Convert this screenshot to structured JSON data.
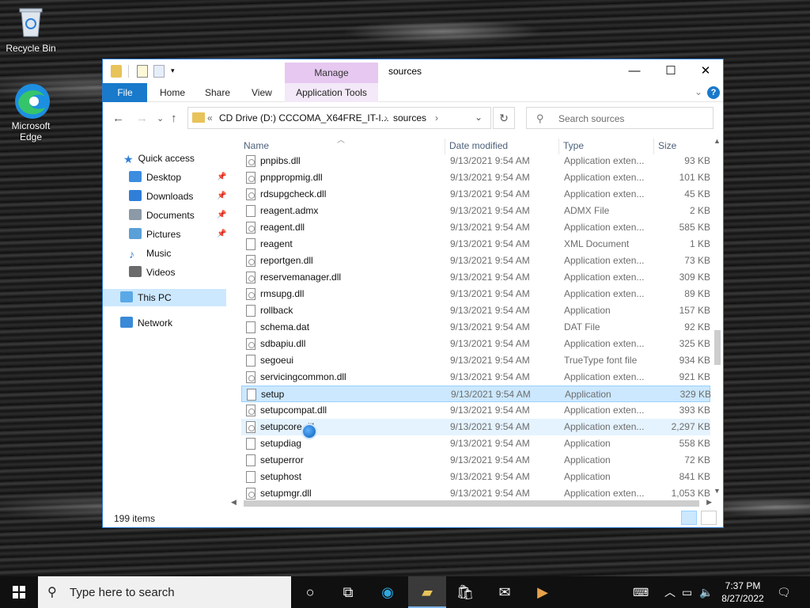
{
  "desktop": {
    "icons": [
      {
        "label": "Recycle Bin",
        "icon": "recycle-bin-icon"
      },
      {
        "label": "Microsoft Edge",
        "icon": "edge-icon"
      }
    ]
  },
  "window": {
    "title": "sources",
    "manage_tab": "Manage",
    "controls": {
      "minimize": "—",
      "maximize": "☐",
      "close": "✕"
    }
  },
  "ribbon": {
    "tabs": [
      "File",
      "Home",
      "Share",
      "View",
      "Application Tools"
    ],
    "help": "?"
  },
  "address": {
    "prefix": "«",
    "segments": [
      "CD Drive (D:) CCCOMA_X64FRE_IT-I...",
      "sources"
    ],
    "separator": "›"
  },
  "search": {
    "placeholder": "Search sources"
  },
  "nav": {
    "quick_access": "Quick access",
    "items": [
      {
        "label": "Desktop",
        "pinned": true,
        "color": "#3c8de0"
      },
      {
        "label": "Downloads",
        "pinned": true,
        "color": "#2f7fd8"
      },
      {
        "label": "Documents",
        "pinned": true,
        "color": "#8c9aa8"
      },
      {
        "label": "Pictures",
        "pinned": true,
        "color": "#5aa0d8"
      },
      {
        "label": "Music",
        "pinned": false,
        "color": "#2f7fd8"
      },
      {
        "label": "Videos",
        "pinned": false,
        "color": "#6b6b6b"
      }
    ],
    "this_pc": "This PC",
    "network": "Network",
    "pin_glyph": "📌"
  },
  "list": {
    "columns": {
      "name": "Name",
      "date": "Date modified",
      "type": "Type",
      "size": "Size"
    },
    "rows": [
      {
        "name": "pnpibs.dll",
        "date": "9/13/2021 9:54 AM",
        "type": "Application exten...",
        "size": "93 KB",
        "icon": "dll"
      },
      {
        "name": "pnppropmig.dll",
        "date": "9/13/2021 9:54 AM",
        "type": "Application exten...",
        "size": "101 KB",
        "icon": "dll"
      },
      {
        "name": "rdsupgcheck.dll",
        "date": "9/13/2021 9:54 AM",
        "type": "Application exten...",
        "size": "45 KB",
        "icon": "dll"
      },
      {
        "name": "reagent.admx",
        "date": "9/13/2021 9:54 AM",
        "type": "ADMX File",
        "size": "2 KB",
        "icon": "file"
      },
      {
        "name": "reagent.dll",
        "date": "9/13/2021 9:54 AM",
        "type": "Application exten...",
        "size": "585 KB",
        "icon": "dll"
      },
      {
        "name": "reagent",
        "date": "9/13/2021 9:54 AM",
        "type": "XML Document",
        "size": "1 KB",
        "icon": "file"
      },
      {
        "name": "reportgen.dll",
        "date": "9/13/2021 9:54 AM",
        "type": "Application exten...",
        "size": "73 KB",
        "icon": "dll"
      },
      {
        "name": "reservemanager.dll",
        "date": "9/13/2021 9:54 AM",
        "type": "Application exten...",
        "size": "309 KB",
        "icon": "dll"
      },
      {
        "name": "rmsupg.dll",
        "date": "9/13/2021 9:54 AM",
        "type": "Application exten...",
        "size": "89 KB",
        "icon": "dll"
      },
      {
        "name": "rollback",
        "date": "9/13/2021 9:54 AM",
        "type": "Application",
        "size": "157 KB",
        "icon": "file"
      },
      {
        "name": "schema.dat",
        "date": "9/13/2021 9:54 AM",
        "type": "DAT File",
        "size": "92 KB",
        "icon": "file"
      },
      {
        "name": "sdbapiu.dll",
        "date": "9/13/2021 9:54 AM",
        "type": "Application exten...",
        "size": "325 KB",
        "icon": "dll"
      },
      {
        "name": "segoeui",
        "date": "9/13/2021 9:54 AM",
        "type": "TrueType font file",
        "size": "934 KB",
        "icon": "file"
      },
      {
        "name": "servicingcommon.dll",
        "date": "9/13/2021 9:54 AM",
        "type": "Application exten...",
        "size": "921 KB",
        "icon": "dll"
      },
      {
        "name": "setup",
        "date": "9/13/2021 9:54 AM",
        "type": "Application",
        "size": "329 KB",
        "icon": "file",
        "state": "sel"
      },
      {
        "name": "setupcompat.dll",
        "date": "9/13/2021 9:54 AM",
        "type": "Application exten...",
        "size": "393 KB",
        "icon": "dll"
      },
      {
        "name": "setupcore.dll",
        "date": "9/13/2021 9:54 AM",
        "type": "Application exten...",
        "size": "2,297 KB",
        "icon": "dll",
        "state": "hover"
      },
      {
        "name": "setupdiag",
        "date": "9/13/2021 9:54 AM",
        "type": "Application",
        "size": "558 KB",
        "icon": "file"
      },
      {
        "name": "setuperror",
        "date": "9/13/2021 9:54 AM",
        "type": "Application",
        "size": "72 KB",
        "icon": "file"
      },
      {
        "name": "setuphost",
        "date": "9/13/2021 9:54 AM",
        "type": "Application",
        "size": "841 KB",
        "icon": "file"
      },
      {
        "name": "setupmgr.dll",
        "date": "9/13/2021 9:54 AM",
        "type": "Application exten...",
        "size": "1,053 KB",
        "icon": "dll"
      }
    ]
  },
  "status": {
    "items_count": "199 items"
  },
  "taskbar": {
    "search_placeholder": "Type here to search",
    "time": "7:37 PM",
    "date": "8/27/2022"
  }
}
